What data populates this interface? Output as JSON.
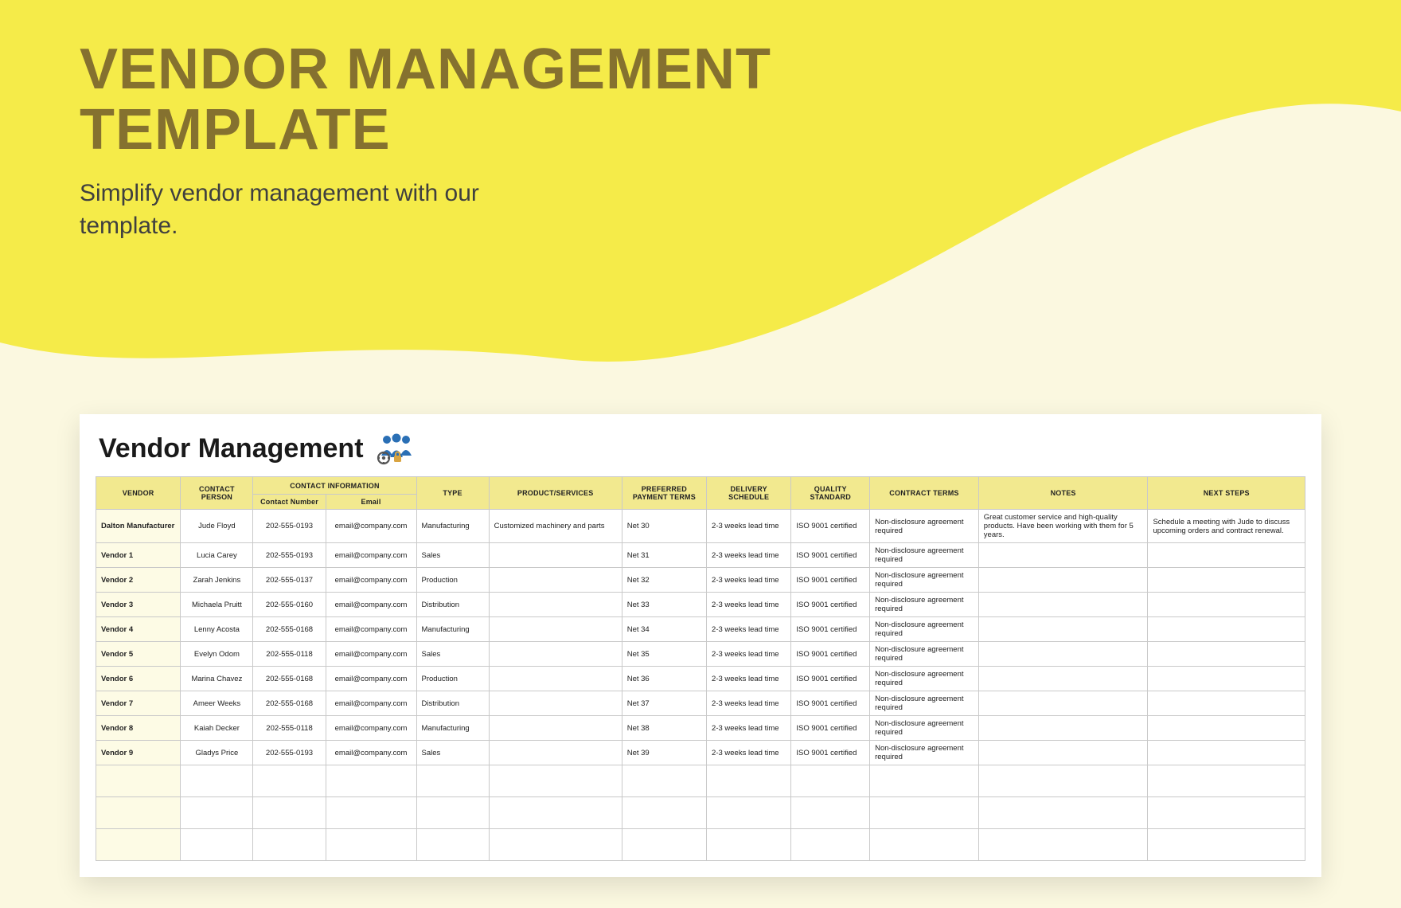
{
  "hero": {
    "title_line1": "VENDOR MANAGEMENT",
    "title_line2": "TEMPLATE",
    "subtitle": "Simplify vendor management with our template."
  },
  "sheet": {
    "title": "Vendor Management"
  },
  "headers": {
    "vendor": "VENDOR",
    "contact_person": "CONTACT PERSON",
    "contact_info": "CONTACT INFORMATION",
    "contact_number": "Contact Number",
    "email": "Email",
    "type": "TYPE",
    "product_services": "PRODUCT/SERVICES",
    "preferred_payment": "PREFERRED PAYMENT TERMS",
    "delivery": "DELIVERY SCHEDULE",
    "quality": "QUALITY STANDARD",
    "contract": "CONTRACT TERMS",
    "notes": "NOTES",
    "next_steps": "NEXT STEPS"
  },
  "rows": [
    {
      "vendor": "Dalton Manufacturer",
      "contact": "Jude Floyd",
      "number": "202-555-0193",
      "email": "email@company.com",
      "type": "Manufacturing",
      "product": "Customized machinery and parts",
      "payment": "Net 30",
      "delivery": "2-3 weeks lead time",
      "quality": "ISO 9001 certified",
      "contract": "Non-disclosure agreement required",
      "notes": "Great customer service and high-quality products. Have been working with them for 5 years.",
      "next": "Schedule a meeting with Jude to discuss upcoming orders and contract renewal."
    },
    {
      "vendor": "Vendor 1",
      "contact": "Lucia Carey",
      "number": "202-555-0193",
      "email": "email@company.com",
      "type": "Sales",
      "product": "",
      "payment": "Net 31",
      "delivery": "2-3 weeks lead time",
      "quality": "ISO 9001 certified",
      "contract": "Non-disclosure agreement required",
      "notes": "",
      "next": ""
    },
    {
      "vendor": "Vendor 2",
      "contact": "Zarah Jenkins",
      "number": "202-555-0137",
      "email": "email@company.com",
      "type": "Production",
      "product": "",
      "payment": "Net 32",
      "delivery": "2-3 weeks lead time",
      "quality": "ISO 9001 certified",
      "contract": "Non-disclosure agreement required",
      "notes": "",
      "next": ""
    },
    {
      "vendor": "Vendor 3",
      "contact": "Michaela Pruitt",
      "number": "202-555-0160",
      "email": "email@company.com",
      "type": "Distribution",
      "product": "",
      "payment": "Net 33",
      "delivery": "2-3 weeks lead time",
      "quality": "ISO 9001 certified",
      "contract": "Non-disclosure agreement required",
      "notes": "",
      "next": ""
    },
    {
      "vendor": "Vendor 4",
      "contact": "Lenny Acosta",
      "number": "202-555-0168",
      "email": "email@company.com",
      "type": "Manufacturing",
      "product": "",
      "payment": "Net 34",
      "delivery": "2-3 weeks lead time",
      "quality": "ISO 9001 certified",
      "contract": "Non-disclosure agreement required",
      "notes": "",
      "next": ""
    },
    {
      "vendor": "Vendor 5",
      "contact": "Evelyn Odom",
      "number": "202-555-0118",
      "email": "email@company.com",
      "type": "Sales",
      "product": "",
      "payment": "Net 35",
      "delivery": "2-3 weeks lead time",
      "quality": "ISO 9001 certified",
      "contract": "Non-disclosure agreement required",
      "notes": "",
      "next": ""
    },
    {
      "vendor": "Vendor 6",
      "contact": "Marina Chavez",
      "number": "202-555-0168",
      "email": "email@company.com",
      "type": "Production",
      "product": "",
      "payment": "Net 36",
      "delivery": "2-3 weeks lead time",
      "quality": "ISO 9001 certified",
      "contract": "Non-disclosure agreement required",
      "notes": "",
      "next": ""
    },
    {
      "vendor": "Vendor 7",
      "contact": "Ameer Weeks",
      "number": "202-555-0168",
      "email": "email@company.com",
      "type": "Distribution",
      "product": "",
      "payment": "Net 37",
      "delivery": "2-3 weeks lead time",
      "quality": "ISO 9001 certified",
      "contract": "Non-disclosure agreement required",
      "notes": "",
      "next": ""
    },
    {
      "vendor": "Vendor 8",
      "contact": "Kaiah Decker",
      "number": "202-555-0118",
      "email": "email@company.com",
      "type": "Manufacturing",
      "product": "",
      "payment": "Net 38",
      "delivery": "2-3 weeks lead time",
      "quality": "ISO 9001 certified",
      "contract": "Non-disclosure agreement required",
      "notes": "",
      "next": ""
    },
    {
      "vendor": "Vendor 9",
      "contact": "Gladys Price",
      "number": "202-555-0193",
      "email": "email@company.com",
      "type": "Sales",
      "product": "",
      "payment": "Net 39",
      "delivery": "2-3 weeks lead time",
      "quality": "ISO 9001 certified",
      "contract": "Non-disclosure agreement required",
      "notes": "",
      "next": ""
    }
  ],
  "empty_rows": 3
}
